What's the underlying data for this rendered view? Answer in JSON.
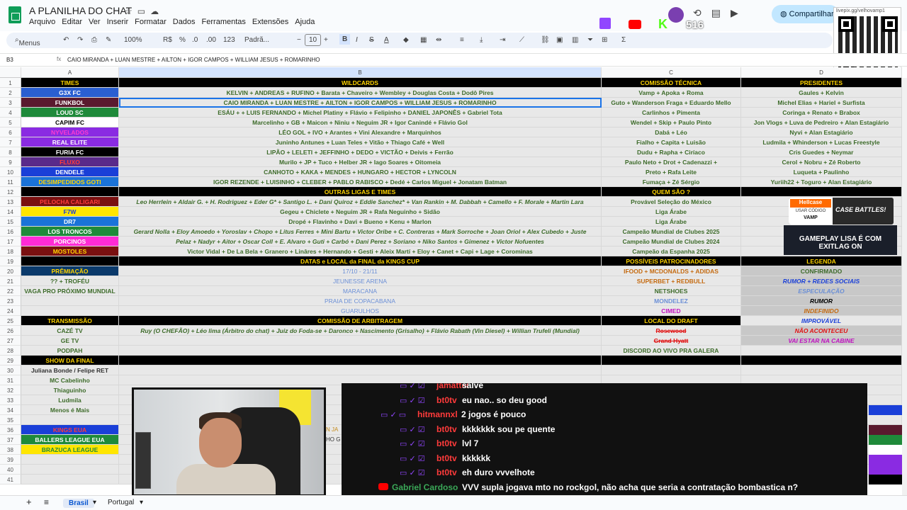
{
  "app": {
    "title": "A PLANILHA DO CHAT",
    "share_label": "Compartilhar"
  },
  "menu": [
    "Arquivo",
    "Editar",
    "Ver",
    "Inserir",
    "Formatar",
    "Dados",
    "Ferramentas",
    "Extensões",
    "Ajuda"
  ],
  "toolbar": {
    "search": "Menus",
    "zoom": "100%",
    "currency": "R$",
    "percent": "%",
    "decimals_less": ".0",
    "decimals_more": ".00",
    "number_format": "123",
    "font": "Padrã...",
    "font_size": "10"
  },
  "formula_bar": {
    "cell_ref": "B3",
    "fx": "fx",
    "formula": "CAIO MIRANDA + LUAN MESTRE + AILTON + IGOR CAMPOS + WILLIAM JESUS + ROMARINHO"
  },
  "columns": [
    "A",
    "B",
    "C",
    "D"
  ],
  "rows": [
    {
      "n": "1",
      "a": "TIMES",
      "b": "WILDCARDS",
      "c": "COMISSÃO TÉCNICA",
      "d": "PRESIDENTES",
      "style": "hd"
    },
    {
      "n": "2",
      "a": "G3X FC",
      "b": "KELVIN + ANDREAS + RUFINO + Barata + Chaveiro + Wembley + Douglas Costa + Dodô Pires",
      "c": "Vamp + Apoka + Roma",
      "d": "Gaules + Kelvin",
      "abg": "#2a5fd1",
      "afg": "#fff"
    },
    {
      "n": "3",
      "a": "FUNKBOL",
      "b": "CAIO MIRANDA + LUAN MESTRE + AILTON + IGOR CAMPOS + WILLIAM JESUS + ROMARINHO",
      "c": "Guto + Wanderson Fraga + Eduardo Mello",
      "d": "Michel Elias + Hariel + Surfista",
      "abg": "#5a1a2e",
      "afg": "#fff"
    },
    {
      "n": "4",
      "a": "LOUD SC",
      "b": "ESÁU + + LUIS FERNANDO + Michel Platiny + Flávio + Felipinho + DANIEL JAPONÊS + Gabriel Tota",
      "c": "Carlinhos + Pimenta",
      "d": "Coringa + Renato + Brabox",
      "abg": "#1f8a3a",
      "afg": "#fff"
    },
    {
      "n": "5",
      "a": "CAPIM FC",
      "b": "Marcelinho + GB + Maicon + Niniu + Neguim JR + Igor Canindé + Flávio Gol",
      "c": "Wendel + Skip + Paulo Pinto",
      "d": "Jon Vlogs + Luva de Pedreiro + Alan Estagiário",
      "abg": "#ffffff",
      "afg": "#000"
    },
    {
      "n": "6",
      "a": "NYVELADOS",
      "b": "LÉO GOL + IVO + Arantes + Vini Alexandre + Marquinhos",
      "c": "Dabá + Léo",
      "d": "Nyvi + Alan Estagiário",
      "abg": "#8a2be2",
      "afg": "#ff3bd0"
    },
    {
      "n": "7",
      "a": "REAL ELITE",
      "b": "Juninho Antunes + Luan Teles + Vitão + Thiago Café + Well",
      "c": "Fialho + Capita + Luisão",
      "d": "Ludmila + Whinderson + Lucas Freestyle",
      "abg": "#8a2be2",
      "afg": "#fff"
    },
    {
      "n": "8",
      "a": "FURIA FC",
      "b": "LIPÃO + LELETI + JEFFINHO + DEDO + VICTÃO + Deivis + Ferrão",
      "c": "Dudu + Rapha + Ciríaco",
      "d": "Cris Guedes + Neymar",
      "abg": "#000000",
      "afg": "#fff"
    },
    {
      "n": "9",
      "a": "FLUXO",
      "b": "Murilo + JP + Tuco + Helber JR + Iago Soares + Oitomeia",
      "c": "Paulo Neto + Drot + Cadenazzi +",
      "d": "Cerol + Nobru + Zé Roberto",
      "abg": "#5a2a8a",
      "afg": "#ff3b3b"
    },
    {
      "n": "10",
      "a": "DENDELE",
      "b": "CANHOTO + KAKA + MENDES + HUNGARO + HECTOR + LYNCOLN",
      "c": "Preto + Rafa Leite",
      "d": "Luqueta + Paulinho",
      "abg": "#1a3fd8",
      "afg": "#fff"
    },
    {
      "n": "11",
      "a": "DESIMPEDIDOS GOTI",
      "b": "IGOR REZENDE + LUISINHO + CLEBER + PABLO RABISCO + Dedé + Carlos Miguel + Jonatam Batman",
      "c": "Fumaça + Zé Sérgio",
      "d": "Yuriih22 + Toguro + Alan Estagiário",
      "abg": "#1a73d8",
      "afg": "#ffd400"
    },
    {
      "n": "12",
      "a": "",
      "b": "OUTRAS LIGAS E TIMES",
      "c": "QUEM SÃO ?",
      "d": "",
      "style": "hd"
    },
    {
      "n": "13",
      "a": "PELOCHA CALIGARI",
      "b": "Leo Herrlein + Aldair G. + H. Rodriguez + Eder G* + Santigo L. + Dani Quiroz + Eddie Sanchez* + Van Rankin + M. Dabbah + Camello + F. Morale + Martin Lara",
      "c": "Provável Seleção do México",
      "d": "",
      "abg": "#7a1010",
      "afg": "#ff3b3b",
      "bit": true
    },
    {
      "n": "14",
      "a": "F7W",
      "b": "Gegeu + Chiclete + Neguim JR + Rafa Neguinho + Sidão",
      "c": "Liga Árabe",
      "d": "",
      "abg": "#ffe600",
      "afg": "#1a3fd8"
    },
    {
      "n": "15",
      "a": "DR7",
      "b": "Dropé + Flavinho + Davi + Bueno + Kenu + Marlon",
      "c": "Liga Árabe",
      "d": "",
      "abg": "#1a73d8",
      "afg": "#fff"
    },
    {
      "n": "16",
      "a": "LOS TRONCOS",
      "b": "Gerard Nolla + Eloy Amoedo + Yoroslav + Chopo + Litus Ferres + Mini Bartu + Victor Oribe + C. Contreras + Mark Sorroche + Joan Oriol + Alex Cubedo + Juste",
      "c": "Campeão Mundial de Clubes 2025",
      "d": "",
      "abg": "#1f8a3a",
      "afg": "#fff",
      "bit": true
    },
    {
      "n": "17",
      "a": "PORCINOS",
      "b": "Pelaz + Nadyr + Aitor + Oscar Coll + E. Alvaro + Guti + Carbó + Dani Perez + Soriano + Niko Santos + Gimenez + Victor Nofuentes",
      "c": "Campeão Mundial de Clubes 2024",
      "d": "",
      "abg": "#ff2bd6",
      "afg": "#fff",
      "bit": true
    },
    {
      "n": "18",
      "a": "MOSTOLES",
      "b": "Victor Vidal + De La Bela + Granero + Linâres + Hernando + Gesti + Aleix Martí + Eloy + Canet + Capi + Lage + Corominas",
      "c": "Campeão da Espanha 2025",
      "d": "",
      "abg": "#7a1010",
      "afg": "#ffd400"
    },
    {
      "n": "19",
      "a": "",
      "b": "DATAS e LOCAL da FINAL da KINGS CUP",
      "c": "POSSÍVEIS PATROCINADORES",
      "d": "LEGENDA",
      "style": "hd"
    },
    {
      "n": "20",
      "a": "PRÊMIAÇÃO",
      "b": "17/10 - 21/11",
      "c": "IFOOD + MCDONALDS + ADIDAS",
      "d": "CONFIRMADO",
      "abg": "#0b3a6b",
      "afg": "#ffd400"
    },
    {
      "n": "21",
      "a": "?? + TROFÉU",
      "b": "JEUNESSE ARENA",
      "c": "SUPERBET + REDBULL",
      "d": "RUMOR + REDES SOCIAIS"
    },
    {
      "n": "22",
      "a": "VAGA PRO PRÓXIMO MUNDIAL",
      "b": "MARACANA",
      "c": "NETSHOES",
      "d": "ESPECULAÇÃO"
    },
    {
      "n": "23",
      "a": "",
      "b": "PRAIA DE COPACABANA",
      "c": "MONDELEZ",
      "d": "RUMOR"
    },
    {
      "n": "24",
      "a": "",
      "b": "GUARULHOS",
      "c": "CIMED",
      "d": "INDEFINIDO"
    },
    {
      "n": "25",
      "a": "TRANSMISSÃO",
      "b": "COMISSÃO DE ARBITRAGEM",
      "c": "LOCAL DO DRAFT",
      "d": "IMPROVÁVEL",
      "style": "hd2"
    },
    {
      "n": "26",
      "a": "CAZÉ TV",
      "b": "Ruy (O CHEFÃO) + Léo lima (Árbitro do chat) + Juiz do Foda-se + Daronco + Nascimento (Grisalho) + Flávio Rabath (Vin Diesel) + Willian Trufeli (Mundial)",
      "c": "Rosewood",
      "d": "NÃO ACONTECEU"
    },
    {
      "n": "27",
      "a": "GE TV",
      "b": "",
      "c": "Grand Hyatt",
      "d": "VAI ESTAR NA CABINE"
    },
    {
      "n": "28",
      "a": "PODPAH",
      "b": "",
      "c": "DISCORD AO VIVO PRA GALERA",
      "d": ""
    },
    {
      "n": "29",
      "a": "SHOW DA FINAL",
      "b": "",
      "c": "",
      "d": "",
      "style": "hd"
    },
    {
      "n": "30",
      "a": "Juliana Bonde / Felipe RET",
      "b": "",
      "c": "",
      "d": ""
    },
    {
      "n": "31",
      "a": "MC Cabelinho",
      "b": "",
      "c": "",
      "d": ""
    },
    {
      "n": "32",
      "a": "Thiaguinho",
      "b": "",
      "c": "",
      "d": ""
    },
    {
      "n": "33",
      "a": "Ludmila",
      "b": "",
      "c": "",
      "d": ""
    },
    {
      "n": "34",
      "a": "Menos é Mais",
      "b": "",
      "c": "",
      "d": ""
    },
    {
      "n": "35",
      "a": "",
      "b": "",
      "c": "",
      "d": ""
    },
    {
      "n": "36",
      "a": "KINGS EUA",
      "b": "",
      "c": "",
      "d": "",
      "abg": "#1a3fd8",
      "afg": "#ff3b3b"
    },
    {
      "n": "37",
      "a": "BALLERS LEAGUE EUA",
      "b": "",
      "c": "",
      "d": "",
      "abg": "#1f8a3a",
      "afg": "#fff"
    },
    {
      "n": "38",
      "a": "BRAZUCA LEAGUE",
      "b": "",
      "c": "",
      "d": "",
      "abg": "#ffe600",
      "afg": "#1f8a3a"
    },
    {
      "n": "39",
      "a": "",
      "b": "",
      "c": "",
      "d": ""
    },
    {
      "n": "40",
      "a": "",
      "b": "",
      "c": "",
      "d": ""
    },
    {
      "n": "41",
      "a": "",
      "b": "",
      "c": "",
      "d": ""
    }
  ],
  "overlay": {
    "qr_label": "livepix.gg/velhovamp1",
    "viewers": "516",
    "ad_hellcase": {
      "brand": "Hellcase",
      "code_label": "USAR CÓDIGO",
      "code": "VAMP",
      "text": "CASE BATTLES!"
    },
    "ad_exitlag": "GAMEPLAY LISA É COM EXITLAG ON",
    "camera_partial": [
      "N JA",
      "HO G"
    ]
  },
  "chat": [
    {
      "user": "jamattei",
      "text": "salve",
      "platform": "twitch"
    },
    {
      "user": "bt0tv",
      "text": "eu nao.. so deu good",
      "platform": "twitch"
    },
    {
      "user": "hitmannxl",
      "text": "2 jogos é pouco",
      "platform": "twitch"
    },
    {
      "user": "bt0tv",
      "text": "kkkkkkk sou pe quente",
      "platform": "twitch"
    },
    {
      "user": "bt0tv",
      "text": "lvl 7",
      "platform": "twitch"
    },
    {
      "user": "bt0tv",
      "text": "kkkkkk",
      "platform": "twitch"
    },
    {
      "user": "bt0tv",
      "text": "eh duro vvvelhote",
      "platform": "twitch"
    },
    {
      "user": "Gabriel Cardoso",
      "text": "VVV supla jogava mto no rockgol, não acha que seria a contratação bombastica n?",
      "platform": "youtube"
    }
  ],
  "tabs": {
    "add": "+",
    "list": "≡",
    "sheets": [
      "Brasil",
      "Portugal"
    ],
    "active": "Brasil"
  }
}
